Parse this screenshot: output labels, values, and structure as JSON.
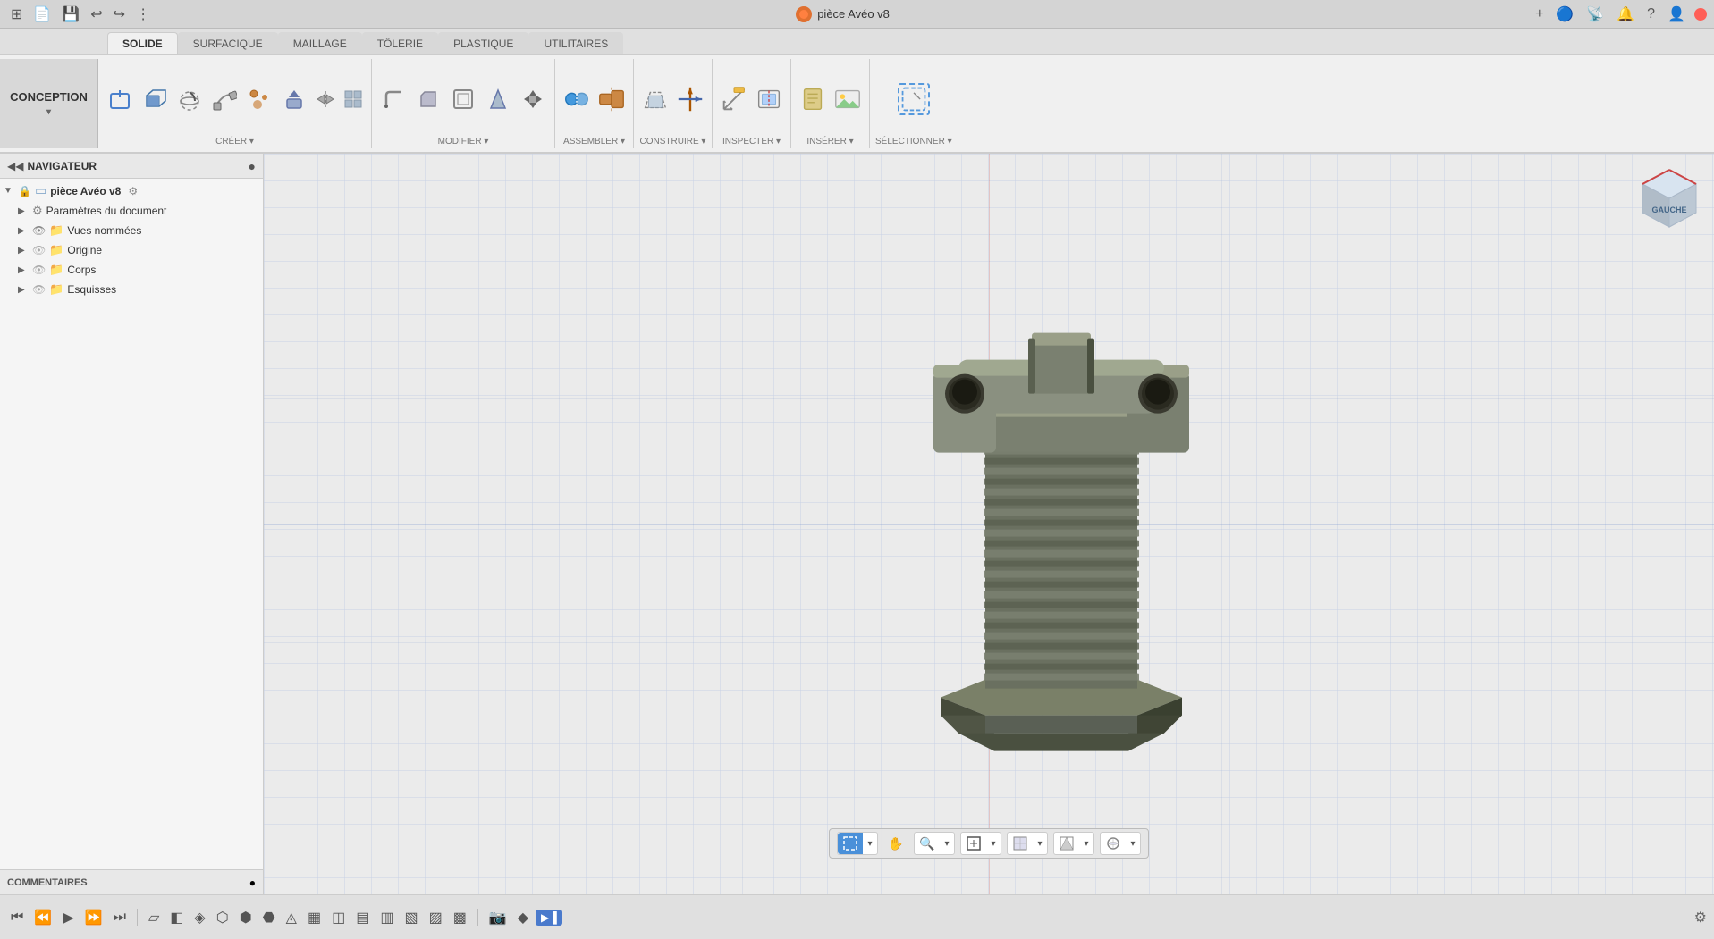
{
  "app": {
    "title": "pièce Avéo v8",
    "icon_color": "#e07030"
  },
  "titlebar": {
    "left_icons": [
      "≡",
      "📄",
      "💾",
      "↩",
      "↪",
      "⋮"
    ],
    "right_icons": [
      "+",
      "🔵",
      "📻",
      "🔔",
      "?",
      "👤"
    ],
    "window_controls": [
      "close",
      "minimize",
      "maximize"
    ]
  },
  "tabs": [
    {
      "label": "SOLIDE",
      "active": true
    },
    {
      "label": "SURFACIQUE",
      "active": false
    },
    {
      "label": "MAILLAGE",
      "active": false
    },
    {
      "label": "TÔLERIE",
      "active": false
    },
    {
      "label": "PLASTIQUE",
      "active": false
    },
    {
      "label": "UTILITAIRES",
      "active": false
    }
  ],
  "conception": {
    "label": "CONCEPTION",
    "dropdown_arrow": "▾"
  },
  "toolbar": {
    "groups": [
      {
        "name": "CRÉER",
        "icons": [
          "create1",
          "create2",
          "create3",
          "create4",
          "create5",
          "create6"
        ]
      },
      {
        "name": "MODIFIER",
        "icons": [
          "mod1",
          "mod2",
          "mod3",
          "mod4",
          "mod5"
        ]
      },
      {
        "name": "ASSEMBLER",
        "icons": [
          "asm1",
          "asm2"
        ]
      },
      {
        "name": "CONSTRUIRE",
        "icons": [
          "cstr1",
          "cstr2"
        ]
      },
      {
        "name": "INSPECTER",
        "icons": [
          "insp1",
          "insp2"
        ]
      },
      {
        "name": "INSÉRER",
        "icons": [
          "ins1",
          "ins2"
        ]
      },
      {
        "name": "SÉLECTIONNER",
        "icons": [
          "sel1"
        ]
      }
    ]
  },
  "navigator": {
    "title": "NAVIGATEUR",
    "items": [
      {
        "label": "pièce Avéo v8",
        "level": 0,
        "type": "doc",
        "bold": true
      },
      {
        "label": "Paramètres du document",
        "level": 1,
        "type": "settings"
      },
      {
        "label": "Vues nommées",
        "level": 1,
        "type": "folder"
      },
      {
        "label": "Origine",
        "level": 1,
        "type": "folder"
      },
      {
        "label": "Corps",
        "level": 1,
        "type": "folder"
      },
      {
        "label": "Esquisses",
        "level": 1,
        "type": "folder"
      }
    ]
  },
  "comments": {
    "label": "COMMENTAIRES"
  },
  "bottom_toolbar": {
    "buttons": [
      "⊞",
      "✋",
      "🔍+",
      "🔍-",
      "🔲",
      "▦",
      "⊕"
    ]
  },
  "statusbar": {
    "icons": [
      "⏮",
      "⏪",
      "▶",
      "⏩",
      "⏭",
      "🎬",
      "🖼",
      "🔲",
      "📐",
      "🔧",
      "🔨",
      "📊",
      "📷",
      "🎞",
      "📁",
      "⚡",
      "📏",
      "✏",
      "⊠"
    ]
  },
  "viewcube": {
    "label": "GAUCHE"
  }
}
